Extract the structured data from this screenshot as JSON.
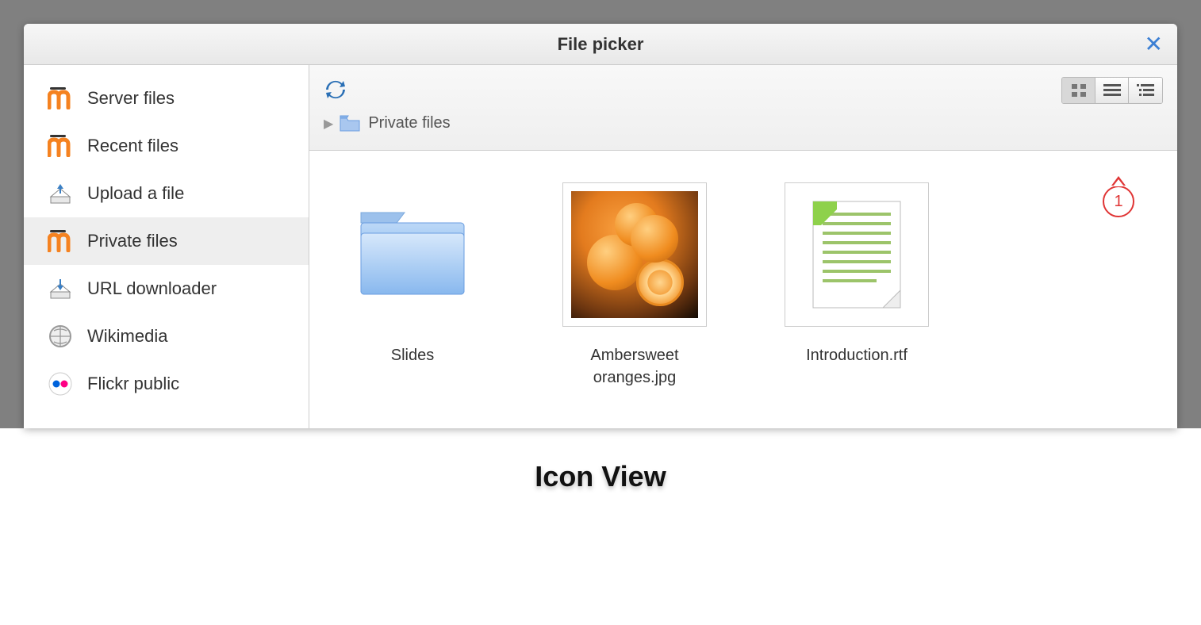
{
  "dialog": {
    "title": "File picker"
  },
  "sidebar": {
    "items": [
      {
        "label": "Server files",
        "icon": "moodle"
      },
      {
        "label": "Recent files",
        "icon": "moodle"
      },
      {
        "label": "Upload a file",
        "icon": "upload"
      },
      {
        "label": "Private files",
        "icon": "moodle",
        "active": true
      },
      {
        "label": "URL downloader",
        "icon": "download"
      },
      {
        "label": "Wikimedia",
        "icon": "wikimedia"
      },
      {
        "label": "Flickr public",
        "icon": "flickr"
      }
    ]
  },
  "breadcrumb": {
    "path": "Private files"
  },
  "files": [
    {
      "label": "Slides",
      "type": "folder"
    },
    {
      "label": "Ambersweet oranges.jpg",
      "type": "image"
    },
    {
      "label": "Introduction.rtf",
      "type": "document"
    }
  ],
  "callout": {
    "number": "1"
  },
  "caption": "Icon View"
}
